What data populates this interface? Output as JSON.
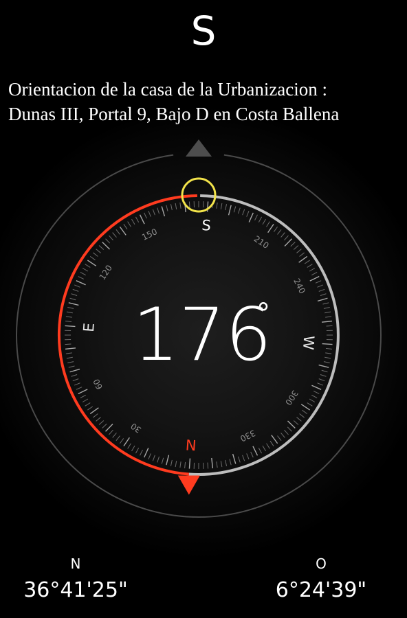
{
  "heading": {
    "direction": "S",
    "degrees": 176,
    "degrees_text": "176",
    "degree_symbol": "°"
  },
  "caption": {
    "line1": "Orientacion de la casa de la Urbanizacion :",
    "line2": "Dunas III, Portal 9, Bajo D en Costa Ballena"
  },
  "dial": {
    "cardinals": [
      {
        "label": "N",
        "bearing": 0,
        "color": "#ff3b1f"
      },
      {
        "label": "E",
        "bearing": 90,
        "color": "#e6e6e6"
      },
      {
        "label": "S",
        "bearing": 180,
        "color": "#ffffff"
      },
      {
        "label": "W",
        "bearing": 270,
        "color": "#e6e6e6"
      }
    ],
    "numbers": [
      "30",
      "60",
      "120",
      "150",
      "210",
      "240",
      "300",
      "330"
    ]
  },
  "location": {
    "lat_label": "N",
    "lat_value": "36°41'25\"",
    "lon_label": "O",
    "lon_value": "6°24'39\""
  },
  "colors": {
    "accent": "#ff3b1f",
    "highlight_circle": "#f2e34a",
    "ring_gray": "#bdbdbd",
    "outer_ring": "#4a4a4a",
    "top_marker": "#4d4d4d"
  }
}
